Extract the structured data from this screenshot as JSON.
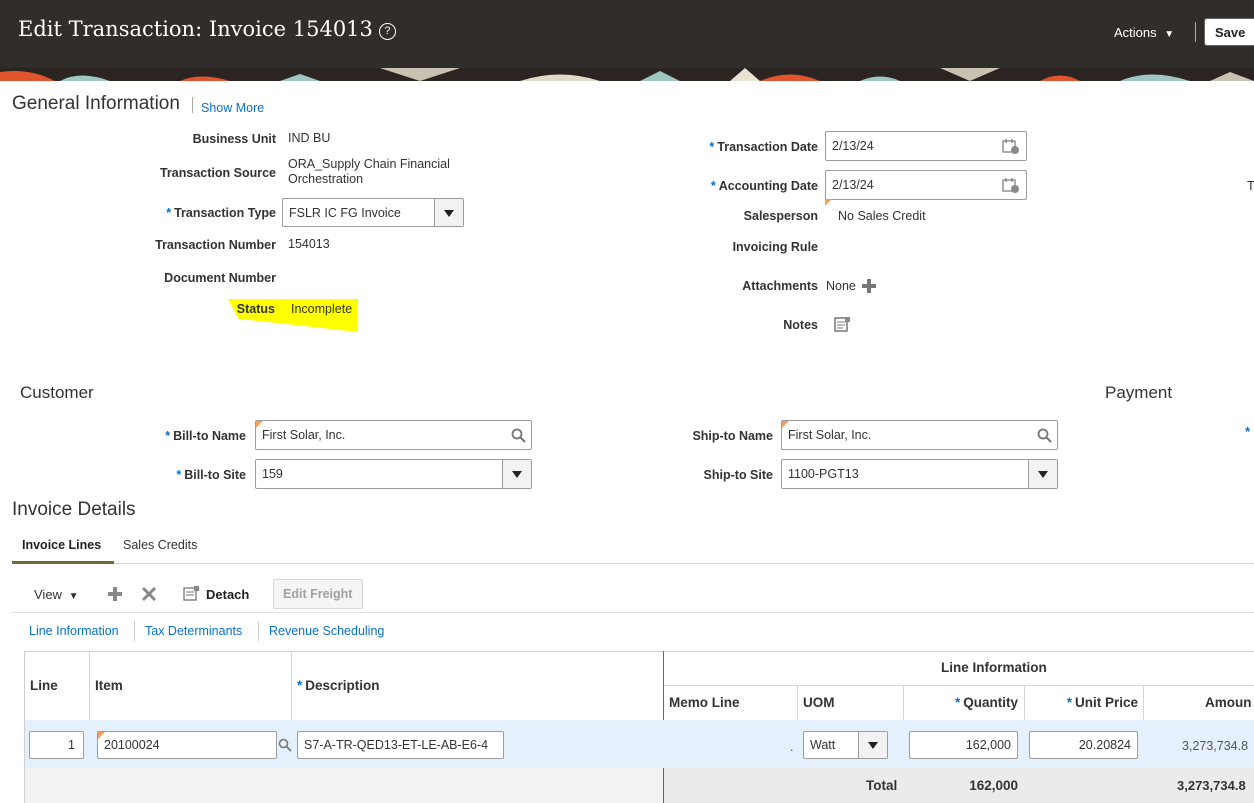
{
  "header": {
    "title": "Edit Transaction: Invoice 154013",
    "help_glyph": "?",
    "actions_label": "Actions",
    "save_label": "Save"
  },
  "general": {
    "heading": "General Information",
    "show_more": "Show More",
    "business_unit": {
      "label": "Business Unit",
      "value": "IND BU"
    },
    "transaction_source": {
      "label": "Transaction Source",
      "value_line1": "ORA_Supply Chain Financial",
      "value_line2": "Orchestration"
    },
    "transaction_type": {
      "label": "Transaction Type",
      "value": "FSLR IC FG Invoice"
    },
    "transaction_number": {
      "label": "Transaction Number",
      "value": "154013"
    },
    "document_number": {
      "label": "Document Number",
      "value": ""
    },
    "status": {
      "label": "Status",
      "value": "Incomplete"
    },
    "transaction_date": {
      "label": "Transaction Date",
      "value": "2/13/24"
    },
    "accounting_date": {
      "label": "Accounting Date",
      "value": "2/13/24"
    },
    "salesperson": {
      "label": "Salesperson",
      "value": "No Sales Credit"
    },
    "invoicing_rule": {
      "label": "Invoicing Rule",
      "value": ""
    },
    "attachments": {
      "label": "Attachments",
      "value": "None"
    },
    "notes": {
      "label": "Notes"
    },
    "cut_label": "T"
  },
  "customer": {
    "heading": "Customer",
    "bill_to_name": {
      "label": "Bill-to Name",
      "value": "First Solar, Inc."
    },
    "bill_to_site": {
      "label": "Bill-to Site",
      "value": "159"
    },
    "ship_to_name": {
      "label": "Ship-to Name",
      "value": "First Solar, Inc."
    },
    "ship_to_site": {
      "label": "Ship-to Site",
      "value": "1100-PGT13"
    }
  },
  "payment": {
    "heading": "Payment",
    "req_mark": "*"
  },
  "invoice_details": {
    "heading": "Invoice Details",
    "tabs": [
      "Invoice Lines",
      "Sales Credits"
    ],
    "toolbar": {
      "view_label": "View",
      "detach_label": "Detach",
      "edit_freight_label": "Edit Freight"
    },
    "sub_links": [
      "Line Information",
      "Tax Determinants",
      "Revenue Scheduling"
    ],
    "table": {
      "group_header": "Line Information",
      "col_line": "Line",
      "col_item": "Item",
      "col_description": "Description",
      "col_memo_line": "Memo Line",
      "col_uom": "UOM",
      "col_quantity": "Quantity",
      "col_unit_price": "Unit Price",
      "col_amount": "Amoun",
      "row": {
        "line": "1",
        "item": "20100024",
        "description": "S7-A-TR-QED13-ET-LE-AB-E6-4",
        "memo_line": ".",
        "uom": "Watt",
        "quantity": "162,000",
        "unit_price": "20.20824",
        "amount": "3,273,734.8"
      },
      "total_label": "Total",
      "total_quantity": "162,000",
      "total_amount": "3,273,734.8"
    }
  },
  "colors": {
    "topbar": "#312d2a",
    "link": "#0572ce",
    "highlight": "#ffff00",
    "selected_row": "#e4f0fb"
  }
}
